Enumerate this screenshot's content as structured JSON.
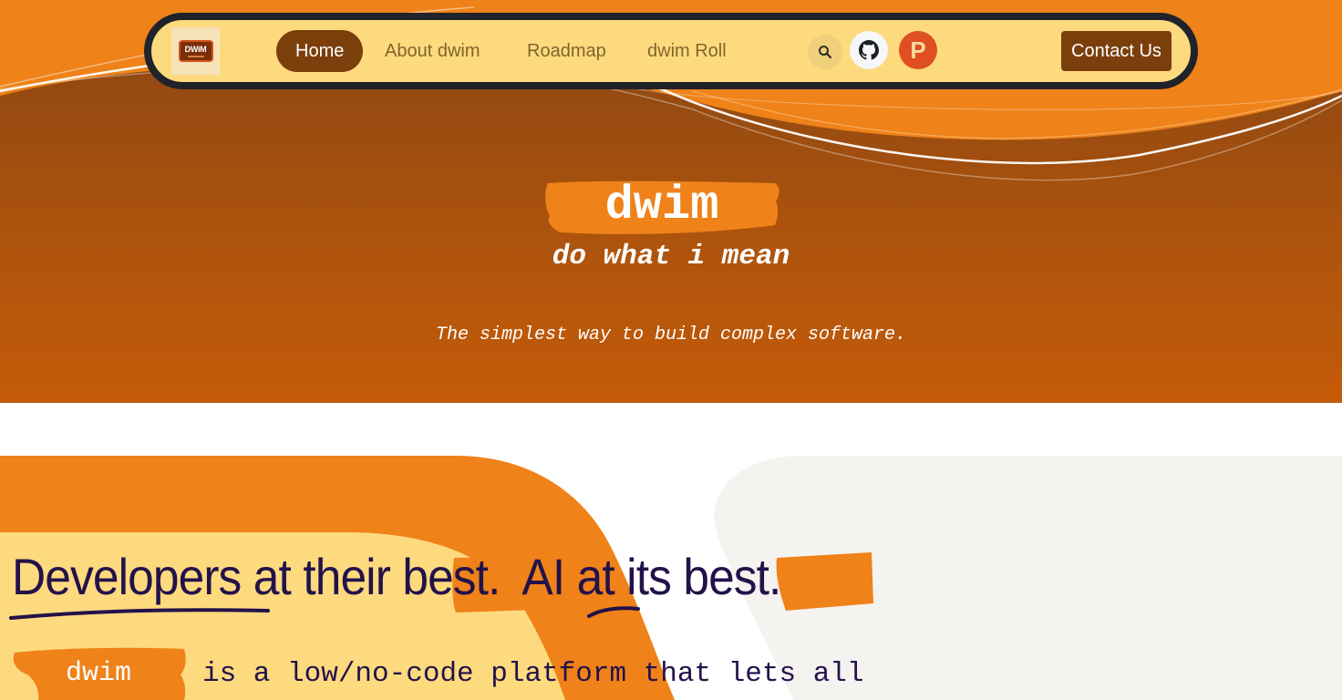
{
  "colors": {
    "brand_orange": "#ef8219",
    "brand_brown": "#7b3f0c",
    "nav_bg": "#fdda7e",
    "nav_border": "#20232a",
    "headline_ink": "#23124a",
    "product_hunt": "#df4f22",
    "light_panel": "#f4f3f0"
  },
  "navbar": {
    "logo_text": "DWiM",
    "logo_alt": "dwim logo",
    "items": [
      {
        "label": "Home",
        "active": true
      },
      {
        "label": "About dwim",
        "active": false
      },
      {
        "label": "Roadmap",
        "active": false
      },
      {
        "label": "dwim Roll",
        "active": false
      }
    ],
    "icons": {
      "search": "search-icon",
      "github": "github-icon",
      "product_hunt": "product-hunt-icon",
      "product_hunt_letter": "P"
    },
    "contact_label": "Contact Us"
  },
  "hero": {
    "title": "dwim",
    "subtitle": "do what i mean",
    "tagline": "The simplest way to build complex software."
  },
  "section2": {
    "headline": {
      "w1": "Developers",
      "w2": " at their ",
      "w3": "best",
      "w4": ".  ",
      "w5": "AI",
      "w6": " at its ",
      "w7": "best",
      "w8": "."
    },
    "badge": "dwim",
    "description": "is a low/no-code platform that lets all"
  }
}
